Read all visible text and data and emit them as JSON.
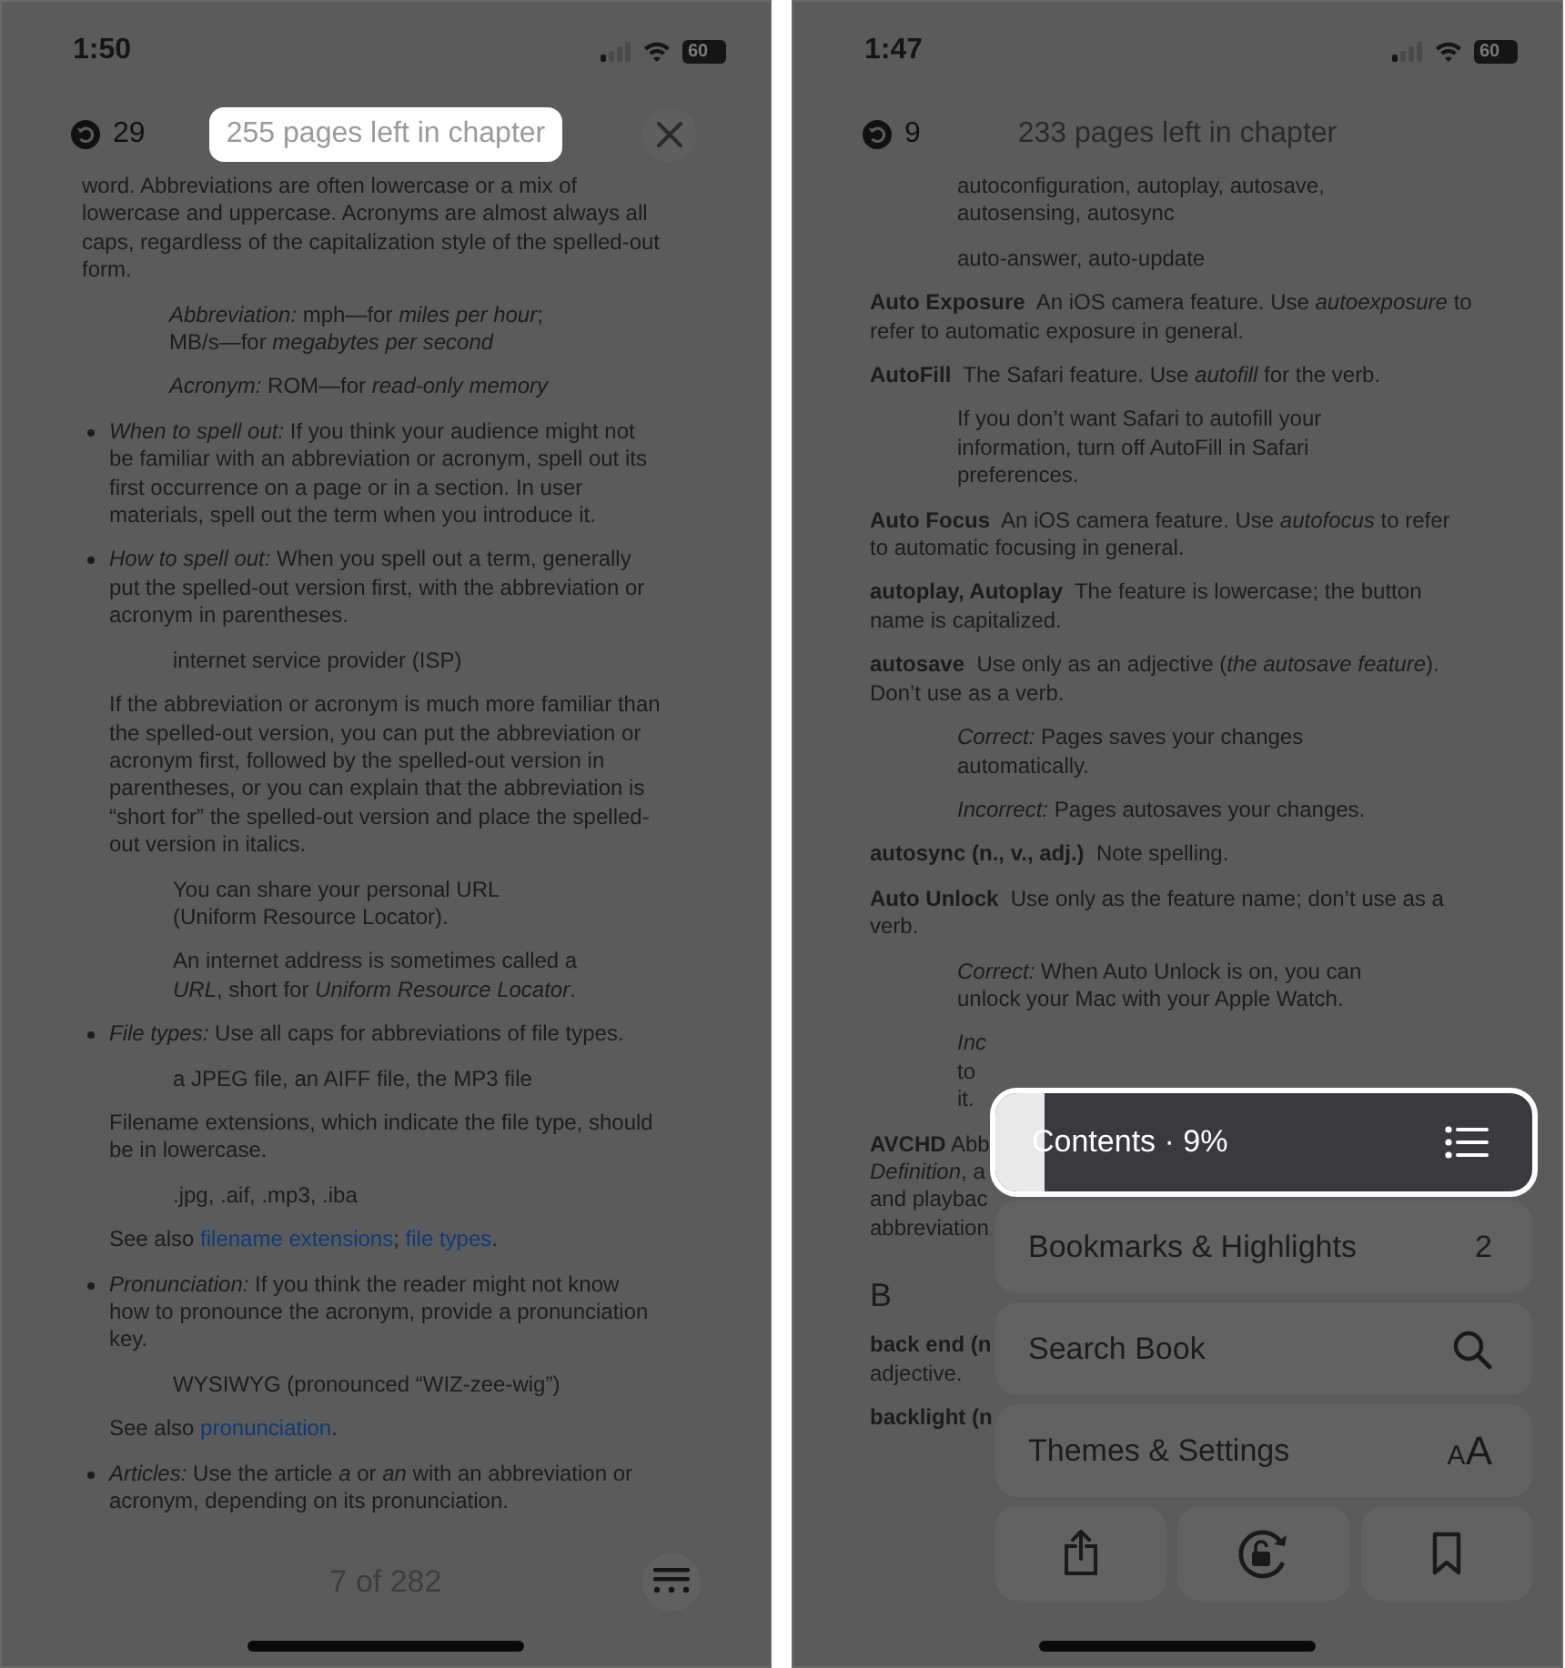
{
  "phones": [
    {
      "status": {
        "time": "1:50",
        "battery": "60"
      },
      "header": {
        "back_count": "29",
        "pages_left": {
          "text": "255 pages left in chapter",
          "highlighted": true
        },
        "close_button": true
      },
      "blocks": [
        {
          "kind": "body",
          "lines": [
            "word. Abbreviations are often lowercase or a mix of",
            "lowercase and uppercase. Acronyms are almost always all",
            "caps, regardless of the capitalization style of the spelled-out",
            "form."
          ]
        },
        {
          "kind": "example",
          "lines": [
            "*Abbreviation:* mph—for *miles per hour*;",
            "MB/s—for *megabytes per second*"
          ]
        },
        {
          "kind": "example",
          "lines": [
            "*Acronym:* ROM—for *read-only memory*"
          ]
        },
        {
          "kind": "bullet",
          "lines": [
            "*When to spell out:* If you think your audience might not",
            "be familiar with an abbreviation or acronym, spell out its",
            "first occurrence on a page or in a section. In user",
            "materials, spell out the term when you introduce it."
          ]
        },
        {
          "kind": "bullet",
          "lines": [
            "*How to spell out:* When you spell out a term, generally",
            "put the spelled-out version first, with the abbreviation or",
            "acronym in parentheses."
          ]
        },
        {
          "kind": "subexample",
          "lines": [
            "internet service provider (ISP)"
          ]
        },
        {
          "kind": "sub",
          "lines": [
            "If the abbreviation or acronym is much more familiar than",
            "the spelled-out version, you can put the abbreviation or",
            "acronym first, followed by the spelled-out version in",
            "parentheses, or you can explain that the abbreviation is",
            "“short for” the spelled-out version and place the spelled-",
            "out version in italics."
          ]
        },
        {
          "kind": "subexample",
          "lines": [
            "You can share your personal URL",
            "(Uniform Resource Locator)."
          ]
        },
        {
          "kind": "subexample",
          "lines": [
            "An internet address is sometimes called a",
            "*URL*, short for *Uniform Resource Locator*."
          ]
        },
        {
          "kind": "bullet",
          "lines": [
            "*File types:* Use all caps for abbreviations of file types."
          ]
        },
        {
          "kind": "subexample",
          "lines": [
            "a JPEG file, an AIFF file, the MP3 file"
          ]
        },
        {
          "kind": "sub",
          "lines": [
            "Filename extensions, which indicate the file type, should",
            "be in lowercase."
          ]
        },
        {
          "kind": "subexample",
          "lines": [
            ".jpg, .aif, .mp3, .iba"
          ]
        },
        {
          "kind": "see_also",
          "segments": [
            {
              "text": "See also "
            },
            {
              "text": "filename extensions",
              "link": true
            },
            {
              "text": "; "
            },
            {
              "text": "file types",
              "link": true
            },
            {
              "text": "."
            }
          ]
        },
        {
          "kind": "bullet",
          "lines": [
            "*Pronunciation:* If you think the reader might not know",
            "how to pronounce the acronym, provide a pronunciation",
            "key."
          ]
        },
        {
          "kind": "subexample",
          "lines": [
            "WYSIWYG (pronounced “WIZ-zee-wig”)"
          ]
        },
        {
          "kind": "see_also",
          "segments": [
            {
              "text": "See also "
            },
            {
              "text": "pronunciation",
              "link": true
            },
            {
              "text": "."
            }
          ]
        },
        {
          "kind": "bullet",
          "lines": [
            "*Articles:* Use the article *a* or *an* with an abbreviation or",
            "acronym, depending on its pronunciation."
          ]
        }
      ],
      "footer": {
        "page": "7 of 282",
        "menu_button": true
      }
    },
    {
      "status": {
        "time": "1:47",
        "battery": "60"
      },
      "header": {
        "back_count": "9",
        "pages_left": {
          "text": "233 pages left in chapter",
          "highlighted": false
        },
        "close_button": false
      },
      "blocks": [
        {
          "kind": "example",
          "lines": [
            "autoconfiguration, autoplay, autosave,",
            "autosensing, autosync"
          ]
        },
        {
          "kind": "example",
          "lines": [
            "auto-answer, auto-update"
          ]
        },
        {
          "kind": "body",
          "lines": [
            "**Auto Exposure**  An iOS camera feature. Use *autoexposure* to",
            "refer to automatic exposure in general."
          ]
        },
        {
          "kind": "body",
          "lines": [
            "**AutoFill**  The Safari feature. Use *autofill* for the verb."
          ]
        },
        {
          "kind": "example",
          "lines": [
            "If you don’t want Safari to autofill your",
            "information, turn off AutoFill in Safari",
            "preferences."
          ]
        },
        {
          "kind": "body",
          "lines": [
            "**Auto Focus**  An iOS camera feature. Use *autofocus* to refer",
            "to automatic focusing in general."
          ]
        },
        {
          "kind": "body",
          "lines": [
            "**autoplay, Autoplay**  The feature is lowercase; the button",
            "name is capitalized."
          ]
        },
        {
          "kind": "body",
          "lines": [
            "**autosave**  Use only as an adjective (*the autosave feature*).",
            "Don’t use as a verb."
          ]
        },
        {
          "kind": "example",
          "lines": [
            "*Correct:* Pages saves your changes",
            "automatically."
          ]
        },
        {
          "kind": "example",
          "lines": [
            "*Incorrect:* Pages autosaves your changes."
          ]
        },
        {
          "kind": "body",
          "lines": [
            "**autosync (n., v., adj.)**  Note spelling."
          ]
        },
        {
          "kind": "body",
          "lines": [
            "**Auto Unlock**  Use only as the feature name; don’t use as a",
            "verb."
          ]
        },
        {
          "kind": "example",
          "lines": [
            "*Correct:* When Auto Unlock is on, you can",
            "unlock your Mac with your Apple Watch."
          ]
        },
        {
          "kind": "example",
          "lines": [
            "*Inc*",
            "to",
            "it."
          ]
        },
        {
          "kind": "body",
          "lines": [
            "**AVCHD** Abb",
            "*Definition*, a",
            "and playbac",
            "abbreviation"
          ]
        },
        {
          "kind": "heading",
          "text": "B"
        },
        {
          "kind": "body",
          "lines": [
            "**back end (n**",
            "adjective."
          ]
        },
        {
          "kind": "body",
          "lines": [
            "**backlight (n**"
          ]
        }
      ],
      "menu": {
        "contents": {
          "label": "Contents · 9%",
          "level": 0.09,
          "highlighted": true
        },
        "items": [
          {
            "kind": "count",
            "label": "Bookmarks & Highlights",
            "count": "2"
          },
          {
            "kind": "search",
            "label": "Search Book"
          },
          {
            "kind": "themes",
            "label": "Themes & Settings",
            "glyph": "AA"
          }
        ],
        "actions": [
          {
            "kind": "share"
          },
          {
            "kind": "rotation_lock"
          },
          {
            "kind": "bookmark"
          }
        ]
      }
    }
  ]
}
